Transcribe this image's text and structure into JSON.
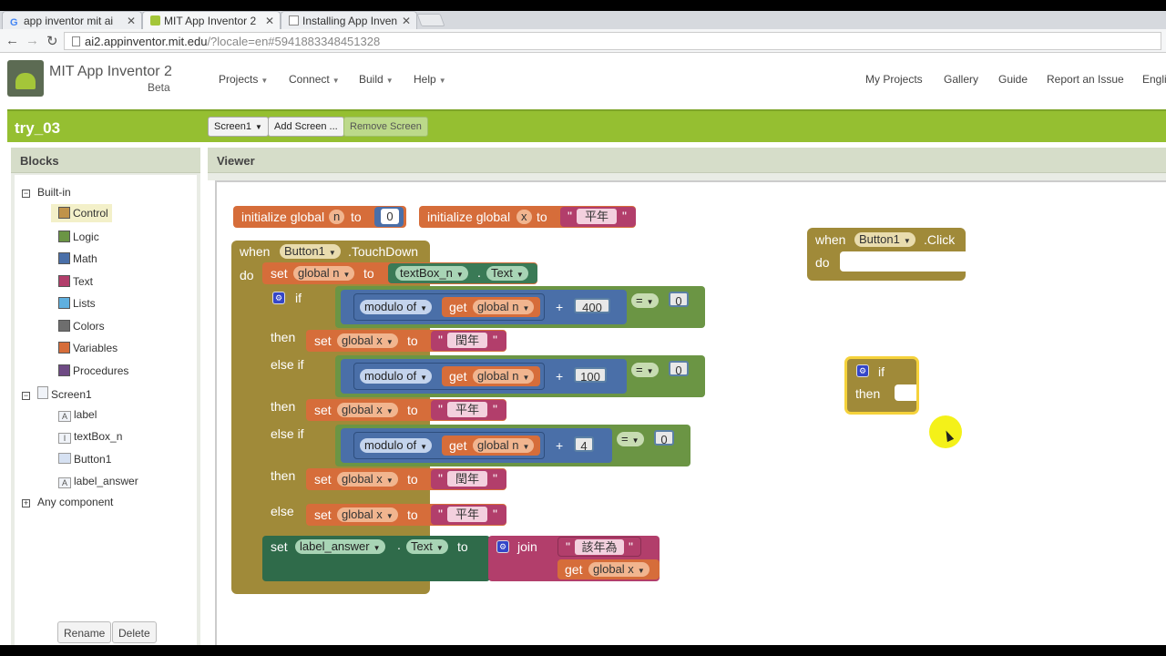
{
  "browser": {
    "tabs": [
      {
        "label": "app inventor mit ai",
        "icon": "google-icon"
      },
      {
        "label": "MIT App Inventor 2",
        "icon": "appinventor-icon"
      },
      {
        "label": "Installing App Inven",
        "icon": "page-icon"
      }
    ],
    "url_main": "ai2.appinventor.mit.edu",
    "url_rest": "/?locale=en#5941883348451328"
  },
  "header": {
    "app_title": "MIT App Inventor 2",
    "beta": "Beta",
    "menus": [
      "Projects",
      "Connect",
      "Build",
      "Help"
    ],
    "links": [
      "My Projects",
      "Gallery",
      "Guide",
      "Report an Issue",
      "Engli"
    ]
  },
  "toolbar": {
    "project": "try_03",
    "screen_select": "Screen1",
    "add_screen": "Add Screen ...",
    "remove_screen": "Remove Screen"
  },
  "blocks_panel": {
    "title": "Blocks",
    "builtin": "Built-in",
    "builtin_items": [
      {
        "label": "Control",
        "color": "#c0934a"
      },
      {
        "label": "Logic",
        "color": "#6b9544"
      },
      {
        "label": "Math",
        "color": "#4a6fa8"
      },
      {
        "label": "Text",
        "color": "#b23e6b"
      },
      {
        "label": "Lists",
        "color": "#5fb0e0"
      },
      {
        "label": "Colors",
        "color": "#6e6e6e"
      },
      {
        "label": "Variables",
        "color": "#d66d3a"
      },
      {
        "label": "Procedures",
        "color": "#6e4a84"
      }
    ],
    "screen": "Screen1",
    "components": [
      "label",
      "textBox_n",
      "Button1",
      "label_answer"
    ],
    "any_component": "Any component",
    "rename": "Rename",
    "delete": "Delete"
  },
  "viewer": {
    "title": "Viewer",
    "init_n": {
      "prefix": "initialize global",
      "name": "n",
      "to": "to",
      "value": "0"
    },
    "init_x": {
      "prefix": "initialize global",
      "name": "x",
      "to": "to",
      "value": "平年"
    },
    "touchdown": {
      "when": "when",
      "component": "Button1",
      "event": ".TouchDown",
      "do": "do"
    },
    "set_n": {
      "set": "set",
      "var": "global n",
      "to": "to",
      "comp": "textBox_n",
      "dot": ".",
      "prop": "Text"
    },
    "if_kw": "if",
    "then_kw": "then",
    "elseif_kw": "else if",
    "else_kw": "else",
    "modulo": "modulo of",
    "get_kw": "get",
    "var_n": "global n",
    "var_x": "global x",
    "plus": "+",
    "eq": "=",
    "cond1": {
      "divisor": "400",
      "rhs": "0"
    },
    "cond2": {
      "divisor": "100",
      "rhs": "0"
    },
    "cond3": {
      "divisor": "4",
      "rhs": "0"
    },
    "val_leap": "閏年",
    "val_common": "平年",
    "set_answer": {
      "set": "set",
      "comp": "label_answer",
      "dot": ".",
      "prop": "Text",
      "to": "to",
      "join": "join",
      "str": "該年為",
      "get": "get",
      "var": "global x"
    },
    "click": {
      "when": "when",
      "component": "Button1",
      "event": ".Click",
      "do": "do"
    },
    "loose_if": {
      "if": "if",
      "then": "then"
    }
  }
}
